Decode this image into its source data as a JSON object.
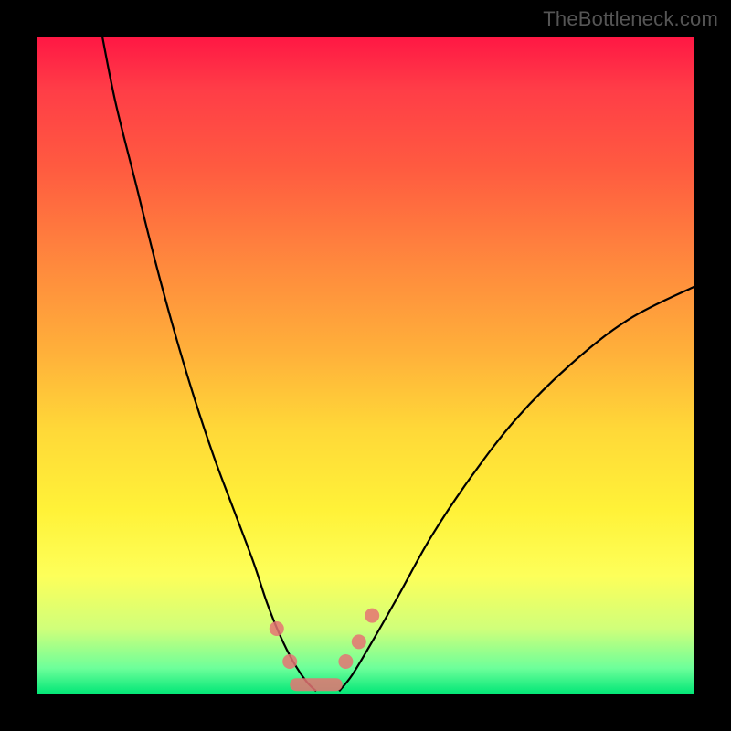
{
  "watermark": "TheBottleneck.com",
  "chart_data": {
    "type": "line",
    "title": "",
    "xlabel": "",
    "ylabel": "",
    "xlim": [
      0,
      100
    ],
    "ylim": [
      0,
      100
    ],
    "series": [
      {
        "name": "left-curve",
        "x": [
          10,
          12,
          15,
          18,
          21,
          24,
          27,
          30,
          33,
          35,
          37,
          39,
          41,
          42.5
        ],
        "y": [
          100,
          90,
          78,
          66,
          55,
          45,
          36,
          28,
          20,
          14,
          9,
          5,
          2,
          0.5
        ]
      },
      {
        "name": "right-curve",
        "x": [
          46,
          48,
          51,
          55,
          60,
          66,
          73,
          81,
          90,
          100
        ],
        "y": [
          0.5,
          3,
          8,
          15,
          24,
          33,
          42,
          50,
          57,
          62
        ]
      }
    ],
    "markers": {
      "name": "highlight-points",
      "color": "#e57373",
      "points": [
        {
          "x": 36.5,
          "y": 10
        },
        {
          "x": 38.5,
          "y": 5
        },
        {
          "x": 47.0,
          "y": 5
        },
        {
          "x": 49.0,
          "y": 8
        },
        {
          "x": 51.0,
          "y": 12
        }
      ],
      "floor_segment": {
        "x0": 38.5,
        "x1": 46.5,
        "y": 1.5
      }
    }
  }
}
